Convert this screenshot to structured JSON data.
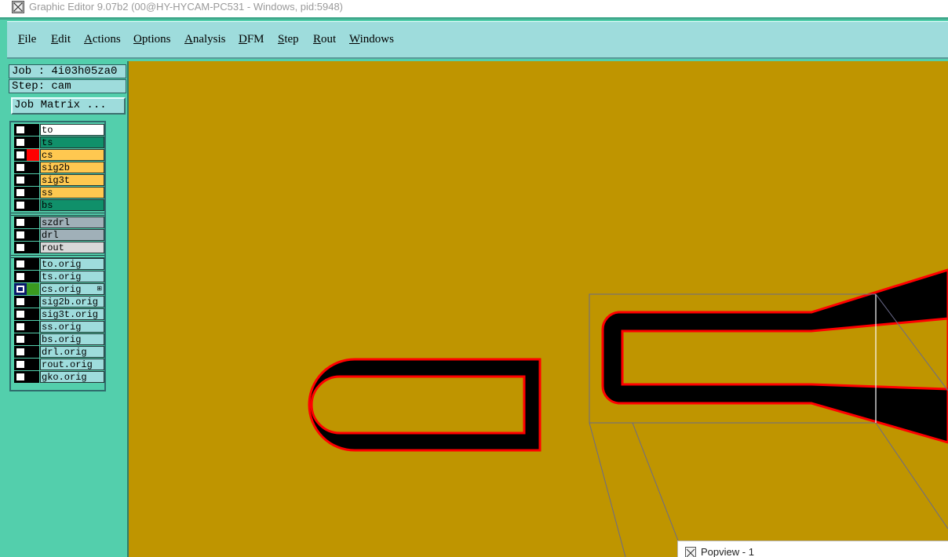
{
  "window": {
    "title": "Graphic Editor 9.07b2 (00@HY-HYCAM-PC531 - Windows, pid:5948)"
  },
  "menu": [
    {
      "label": "File"
    },
    {
      "label": "Edit"
    },
    {
      "label": "Actions"
    },
    {
      "label": "Options"
    },
    {
      "label": "Analysis"
    },
    {
      "label": "DFM"
    },
    {
      "label": "Step"
    },
    {
      "label": "Rout"
    },
    {
      "label": "Windows"
    }
  ],
  "job": {
    "job_label": "Job : 4i03h05za0",
    "step_label": "Step: cam",
    "matrix_button": "Job Matrix ..."
  },
  "layers": {
    "board": [
      {
        "name": "to",
        "bg": "#ffffff",
        "color": "#000000"
      },
      {
        "name": "ts",
        "bg": "#10906a",
        "color": "#000000"
      },
      {
        "name": "cs",
        "bg": "#ffc850",
        "color": "#ff0000"
      },
      {
        "name": "sig2b",
        "bg": "#ffc850",
        "color": "#000000"
      },
      {
        "name": "sig3t",
        "bg": "#ffc850",
        "color": "#000000"
      },
      {
        "name": "ss",
        "bg": "#ffc850",
        "color": "#000000"
      },
      {
        "name": "bs",
        "bg": "#10906a",
        "color": "#000000"
      }
    ],
    "drill": [
      {
        "name": "szdrl",
        "bg": "#a0b0b8",
        "color": "#000000"
      },
      {
        "name": "drl",
        "bg": "#a0b0b8",
        "color": "#000000"
      },
      {
        "name": "rout",
        "bg": "#d8d8d8",
        "color": "#000000"
      }
    ],
    "misc": [
      {
        "name": "to.orig",
        "bg": "#9edcdc",
        "color": "#000000"
      },
      {
        "name": "ts.orig",
        "bg": "#9edcdc",
        "color": "#000000"
      },
      {
        "name": "cs.orig",
        "bg": "#9edcdc",
        "color": "#3a9a20",
        "selected": true
      },
      {
        "name": "sig2b.orig",
        "bg": "#9edcdc",
        "color": "#000000"
      },
      {
        "name": "sig3t.orig",
        "bg": "#9edcdc",
        "color": "#000000"
      },
      {
        "name": "ss.orig",
        "bg": "#9edcdc",
        "color": "#000000"
      },
      {
        "name": "bs.orig",
        "bg": "#9edcdc",
        "color": "#000000"
      },
      {
        "name": "drl.orig",
        "bg": "#9edcdc",
        "color": "#000000"
      },
      {
        "name": "rout.orig",
        "bg": "#9edcdc",
        "color": "#000000"
      },
      {
        "name": "gko.orig",
        "bg": "#9edcdc",
        "color": "#000000"
      }
    ]
  },
  "colors": {
    "canvas_bg": "#bf9500",
    "feature_fill": "#000000",
    "feature_outline": "#ff0000",
    "frame": "#53cfac",
    "menubar": "#9edcdc"
  },
  "popview": {
    "title": "Popview - 1"
  }
}
